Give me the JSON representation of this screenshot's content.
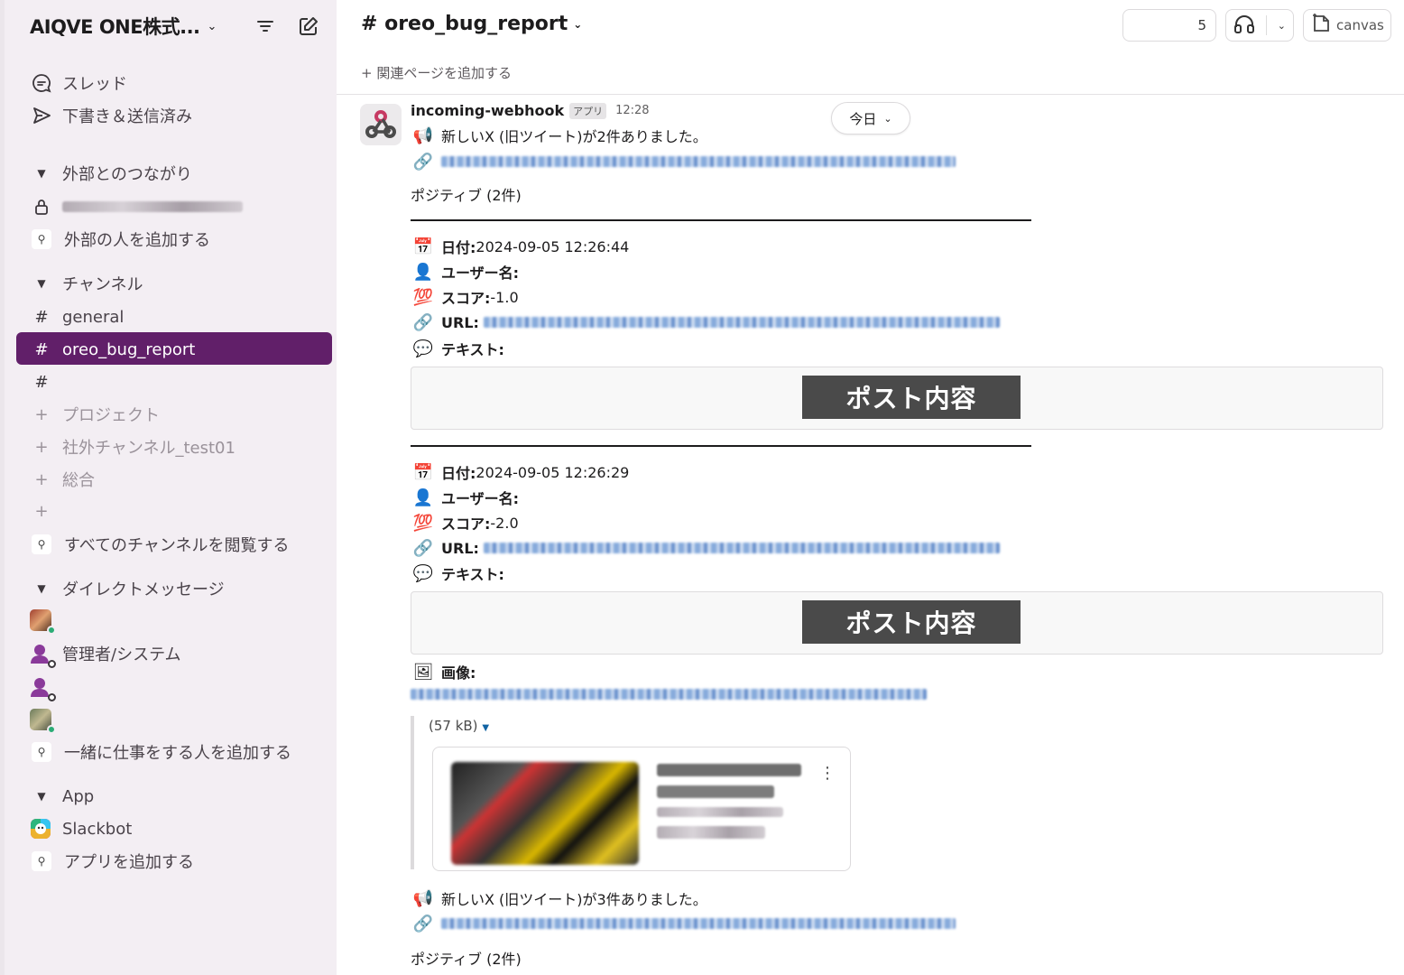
{
  "workspace": {
    "name": "AIQVE ONE株式..."
  },
  "sidebar": {
    "threads": "スレッド",
    "drafts": "下書き＆送信済み",
    "external_section": "外部とのつながり",
    "add_external": "外部の人を追加する",
    "channels_section": "チャンネル",
    "channels": [
      "general",
      "oreo_bug_report"
    ],
    "channel_hash": "#",
    "muted_channels": [
      "プロジェクト",
      "社外チャンネル_test01",
      "総合"
    ],
    "browse_channels": "すべてのチャンネルを閲覧する",
    "dm_section": "ダイレクトメッセージ",
    "dm_admin": "管理者/システム",
    "add_coworkers": "一緒に仕事をする人を追加する",
    "app_section": "App",
    "slackbot": "Slackbot",
    "add_apps": "アプリを追加する"
  },
  "channel": {
    "title": "# oreo_bug_report",
    "add_page": "関連ページを追加する",
    "member_count": "5",
    "canvas": "canvas"
  },
  "message": {
    "sender": "incoming-webhook",
    "badge": "アプリ",
    "time": "12:28",
    "today": "今日",
    "headline1": "新しいX (旧ツイート)が2件ありました。",
    "positive1": "ポジティブ (2件)",
    "posts": [
      {
        "date_label": "日付:",
        "date": " 2024-09-05 12:26:44",
        "user_label": "ユーザー名:",
        "score_label": "スコア:",
        "score": " -1.0",
        "url_label": "URL:",
        "text_label": "テキスト:",
        "post_label": "ポスト内容"
      },
      {
        "date_label": "日付:",
        "date": " 2024-09-05 12:26:29",
        "user_label": "ユーザー名:",
        "score_label": "スコア:",
        "score": " -2.0",
        "url_label": "URL:",
        "text_label": "テキスト:",
        "post_label": "ポスト内容"
      }
    ],
    "image_label": "画像:",
    "file_size": "(57 kB)",
    "headline2": "新しいX (旧ツイート)が3件ありました。",
    "positive2": "ポジティブ (2件)"
  },
  "colors": {
    "sidebar_bg": "#f3eef3",
    "selected": "#611f69",
    "online": "#2bac76"
  }
}
